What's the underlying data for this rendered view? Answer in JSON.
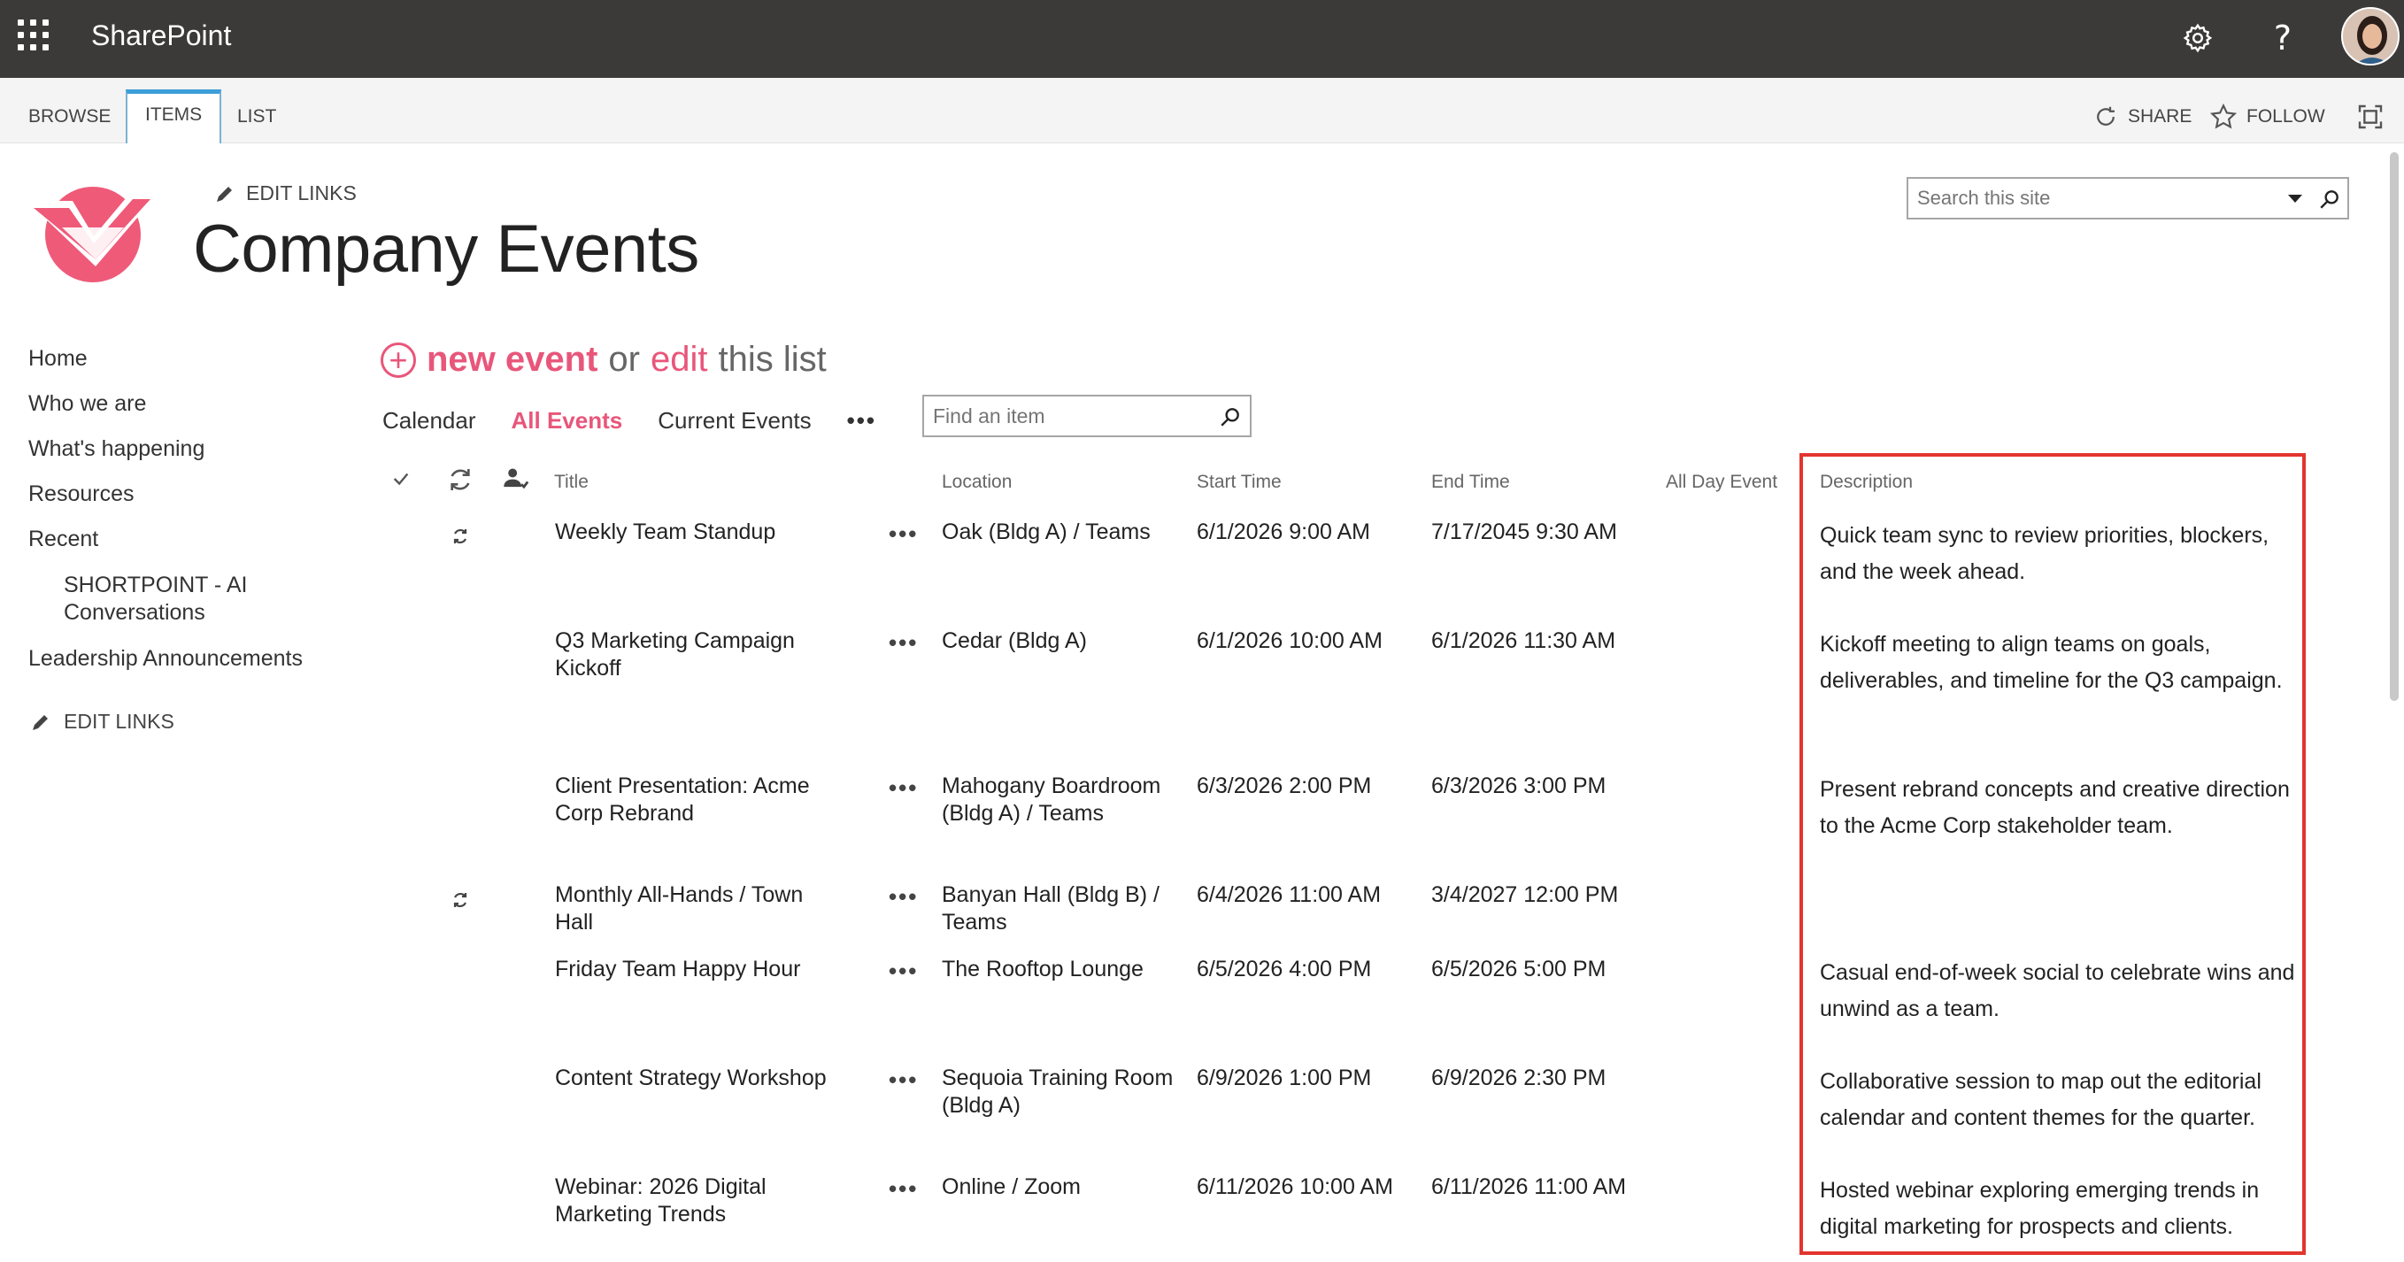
{
  "suitebar": {
    "app_name": "SharePoint",
    "icons": [
      "app-launcher-icon",
      "gear-icon",
      "help-icon",
      "avatar"
    ]
  },
  "ribbon": {
    "tabs": [
      "BROWSE",
      "ITEMS",
      "LIST"
    ],
    "active_tab": "ITEMS",
    "share_label": "SHARE",
    "follow_label": "FOLLOW"
  },
  "header": {
    "edit_links": "EDIT LINKS",
    "title": "Company Events",
    "search_placeholder": "Search this site"
  },
  "leftnav": {
    "items": [
      "Home",
      "Who we are",
      "What's happening",
      "Resources",
      "Recent"
    ],
    "sub_item": "SHORTPOINT - AI Conversations",
    "after_sub": "Leadership Announcements",
    "edit_links": "EDIT LINKS"
  },
  "actions": {
    "new_event": "new event",
    "or": "or",
    "edit": "edit",
    "this_list": "this list"
  },
  "views": {
    "items": [
      "Calendar",
      "All Events",
      "Current Events"
    ],
    "active": "All Events",
    "more": "•••",
    "find_placeholder": "Find an item"
  },
  "table": {
    "columns": [
      "Title",
      "Location",
      "Start Time",
      "End Time",
      "All Day Event",
      "Description"
    ],
    "rows": [
      {
        "title": "Weekly Team Standup",
        "recurring": true,
        "location": "Oak (Bldg A) / Teams",
        "start": "6/1/2026 9:00 AM",
        "end": "7/17/2045 9:30 AM",
        "all_day": "",
        "description": "Quick team sync to review priorities, blockers, and the week ahead."
      },
      {
        "title": "Q3 Marketing Campaign Kickoff",
        "recurring": false,
        "location": "Cedar (Bldg A)",
        "start": "6/1/2026 10:00 AM",
        "end": "6/1/2026 11:30 AM",
        "all_day": "",
        "description": "Kickoff meeting to align teams on goals, deliverables, and timeline for the Q3 campaign."
      },
      {
        "title": "Client Presentation: Acme Corp Rebrand",
        "recurring": false,
        "location": "Mahogany Boardroom (Bldg A) / Teams",
        "start": "6/3/2026 2:00 PM",
        "end": "6/3/2026 3:00 PM",
        "all_day": "",
        "description": "Present rebrand concepts and creative direction to the Acme Corp stakeholder team."
      },
      {
        "title": "Monthly All-Hands / Town Hall",
        "recurring": true,
        "location": "Banyan Hall (Bldg B) / Teams",
        "start": "6/4/2026 11:00 AM",
        "end": "3/4/2027 12:00 PM",
        "all_day": "",
        "description": ""
      },
      {
        "title": "Friday Team Happy Hour",
        "recurring": false,
        "location": "The Rooftop Lounge",
        "start": "6/5/2026 4:00 PM",
        "end": "6/5/2026 5:00 PM",
        "all_day": "",
        "description": "Casual end-of-week social to celebrate wins and unwind as a team."
      },
      {
        "title": "Content Strategy Workshop",
        "recurring": false,
        "location": "Sequoia Training Room (Bldg A)",
        "start": "6/9/2026 1:00 PM",
        "end": "6/9/2026 2:30 PM",
        "all_day": "",
        "description": "Collaborative session to map out the editorial calendar and content themes for the quarter."
      },
      {
        "title": "Webinar: 2026 Digital Marketing Trends",
        "recurring": false,
        "location": "Online / Zoom",
        "start": "6/11/2026 10:00 AM",
        "end": "6/11/2026 11:00 AM",
        "all_day": "",
        "description": "Hosted webinar exploring emerging trends in digital marketing for prospects and clients."
      }
    ]
  },
  "colors": {
    "suitebar": "#3b3a39",
    "accent": "#e8567a",
    "ribbon_active": "#3d9ed8",
    "highlight": "#e3342f"
  }
}
